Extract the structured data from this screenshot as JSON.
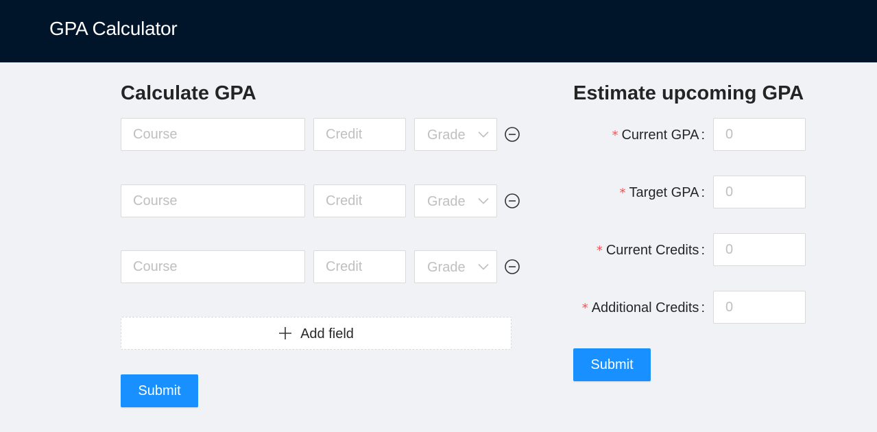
{
  "header": {
    "title": "GPA Calculator"
  },
  "calculate": {
    "title": "Calculate GPA",
    "rows": [
      {
        "course_placeholder": "Course",
        "credit_placeholder": "Credit",
        "grade_placeholder": "Grade"
      },
      {
        "course_placeholder": "Course",
        "credit_placeholder": "Credit",
        "grade_placeholder": "Grade"
      },
      {
        "course_placeholder": "Course",
        "credit_placeholder": "Credit",
        "grade_placeholder": "Grade"
      }
    ],
    "add_field_label": "Add field",
    "submit_label": "Submit"
  },
  "estimate": {
    "title": "Estimate upcoming GPA",
    "required_mark": "*",
    "fields": [
      {
        "label": "Current GPA",
        "placeholder": "0"
      },
      {
        "label": "Target GPA",
        "placeholder": "0"
      },
      {
        "label": "Current Credits",
        "placeholder": "0"
      },
      {
        "label": "Additional Credits",
        "placeholder": "0"
      }
    ],
    "submit_label": "Submit"
  },
  "icons": {
    "remove": "minus-circle-icon",
    "dropdown": "chevron-down-icon",
    "add": "plus-icon"
  },
  "colors": {
    "header_bg": "#001529",
    "page_bg": "#f0f2f5",
    "primary": "#1890ff",
    "required": "#ff4d4f"
  }
}
